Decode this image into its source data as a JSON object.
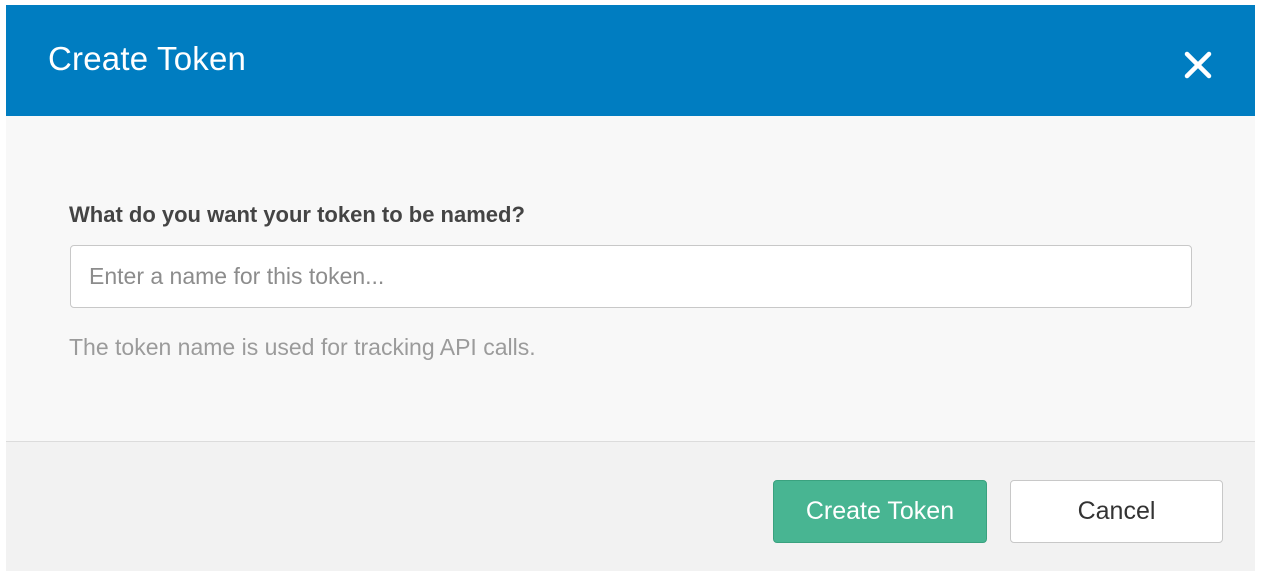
{
  "dialog": {
    "title": "Create Token",
    "close_icon": "close-icon"
  },
  "form": {
    "label": "What do you want your token to be named?",
    "input_value": "",
    "input_placeholder": "Enter a name for this token...",
    "help_text": "The token name is used for tracking API calls."
  },
  "footer": {
    "create_label": "Create Token",
    "cancel_label": "Cancel"
  },
  "colors": {
    "header_bg": "#007dc1",
    "primary_button": "#48b592",
    "body_bg": "#f8f8f8",
    "footer_bg": "#f2f2f2"
  }
}
